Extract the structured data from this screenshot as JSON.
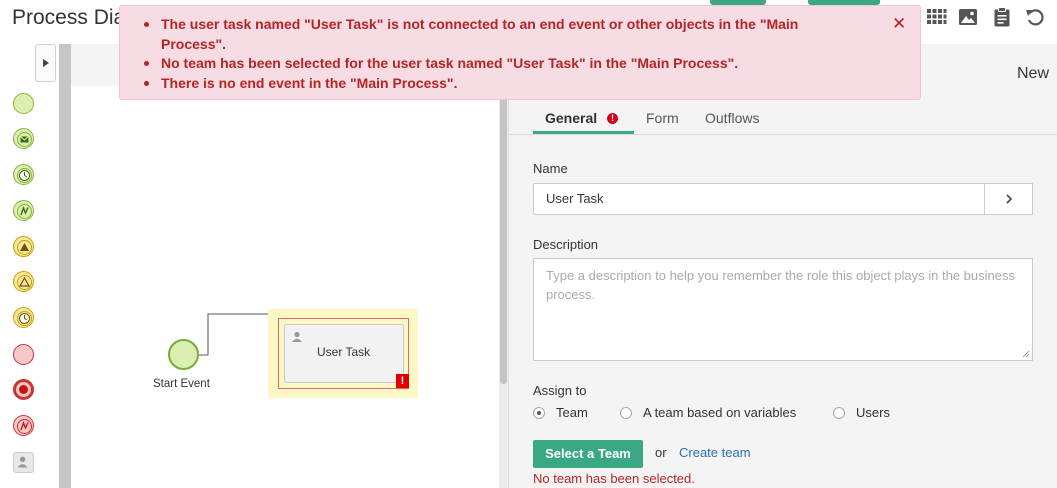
{
  "header": {
    "title": "Process Dia",
    "toolbar_icons": [
      "grid-icon",
      "image-icon",
      "clipboard-icon",
      "undo-icon"
    ]
  },
  "banner": {
    "errors": [
      "The user task named \"User Task\" is not connected to an end event or other objects in the \"Main Process\".",
      "No team has been selected for the user task named \"User Task\" in the \"Main Process\".",
      "There is no end event in the \"Main Process\"."
    ],
    "close_glyph": "✕"
  },
  "palette": {
    "items": [
      "start-event",
      "message-event",
      "timer-event",
      "signal-event",
      "escalation-event",
      "conditional-event",
      "timer-boundary-event",
      "end-event",
      "terminate-end-event",
      "signal-end-event",
      "user-task"
    ]
  },
  "canvas": {
    "start_event_label": "Start Event",
    "task_label": "User Task",
    "task_error_glyph": "!"
  },
  "panel": {
    "heading": "New",
    "tabs": [
      {
        "label": "General",
        "active": true,
        "has_error": true
      },
      {
        "label": "Form",
        "active": false
      },
      {
        "label": "Outflows",
        "active": false
      }
    ],
    "name_label": "Name",
    "name_value": "User Task",
    "description_label": "Description",
    "description_placeholder": "Type a description to help you remember the role this object plays in the business process.",
    "assign_label": "Assign to",
    "assign_options": [
      {
        "label": "Team",
        "selected": true
      },
      {
        "label": "A team based on variables",
        "selected": false
      },
      {
        "label": "Users",
        "selected": false
      }
    ],
    "select_team_button": "Select a Team",
    "or_text": "or",
    "create_team_link": "Create team",
    "team_error": "No team has been selected."
  },
  "colors": {
    "accent": "#3aa885",
    "error": "#b42525",
    "banner_bg": "#f8dce4"
  }
}
